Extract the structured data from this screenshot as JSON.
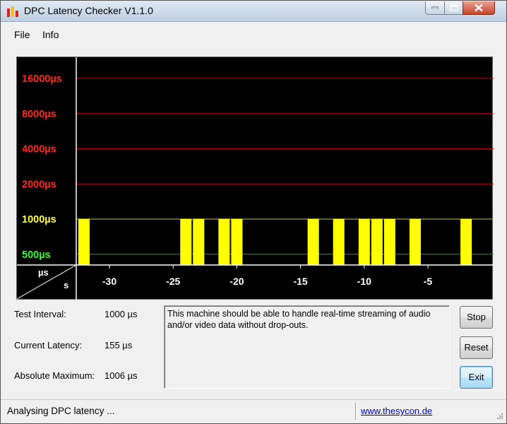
{
  "window": {
    "title": "DPC Latency Checker V1.1.0"
  },
  "menu": {
    "items": [
      "File",
      "Info"
    ]
  },
  "chart_data": {
    "type": "bar",
    "y_scale": "log2",
    "y_ticks": [
      {
        "label": "16000µs",
        "value": 16000,
        "color": "#ff2a1a"
      },
      {
        "label": "8000µs",
        "value": 8000,
        "color": "#ff2a1a"
      },
      {
        "label": "4000µs",
        "value": 4000,
        "color": "#ff2a1a"
      },
      {
        "label": "2000µs",
        "value": 2000,
        "color": "#ff2a1a"
      },
      {
        "label": "1000µs",
        "value": 1000,
        "color": "#ffff33"
      },
      {
        "label": "500µs",
        "value": 500,
        "color": "#33ff33"
      }
    ],
    "x_ticks": [
      -30,
      -25,
      -20,
      -15,
      -10,
      -5
    ],
    "x_tick_labels": [
      "-30",
      "-25",
      "-20",
      "-15",
      "-10",
      "-5"
    ],
    "unit_y": "µs",
    "unit_x": "s",
    "threshold_colors": {
      "low": "#22ff22",
      "mid": "#ffff00",
      "high": "#ff0000"
    },
    "x": [
      -33,
      -32,
      -31,
      -30,
      -29,
      -28,
      -27,
      -26,
      -25,
      -24,
      -23,
      -22,
      -21,
      -20,
      -19,
      -18,
      -17,
      -16,
      -15,
      -14,
      -13,
      -12,
      -11,
      -10,
      -9,
      -8,
      -7,
      -6,
      -5,
      -4,
      -3,
      -2,
      -1,
      0
    ],
    "values": [
      180,
      1006,
      180,
      180,
      180,
      180,
      170,
      180,
      180,
      1006,
      1006,
      180,
      1006,
      1006,
      150,
      180,
      190,
      240,
      300,
      1006,
      180,
      1006,
      180,
      1006,
      1006,
      1006,
      190,
      1006,
      180,
      180,
      180,
      1006,
      180,
      180
    ]
  },
  "stats": {
    "test_interval_label": "Test Interval:",
    "test_interval_value": "1000 µs",
    "current_latency_label": "Current Latency:",
    "current_latency_value": "155 µs",
    "absolute_max_label": "Absolute Maximum:",
    "absolute_max_value": "1006 µs"
  },
  "message": "This machine should be able to handle real-time streaming of audio and/or video data without drop-outs.",
  "buttons": {
    "stop": "Stop",
    "reset": "Reset",
    "exit": "Exit"
  },
  "status": {
    "text": "Analysing DPC latency ...",
    "link": "www.thesycon.de"
  }
}
